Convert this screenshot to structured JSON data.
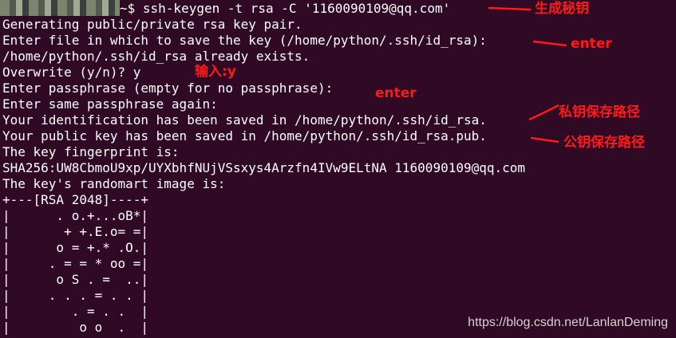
{
  "terminal": {
    "command": "~$ ssh-keygen -t rsa -C '1160090109@qq.com'",
    "output_lines": [
      "Generating public/private rsa key pair.",
      "Enter file in which to save the key (/home/python/.ssh/id_rsa):",
      "/home/python/.ssh/id_rsa already exists.",
      "Overwrite (y/n)? y",
      "Enter passphrase (empty for no passphrase):",
      "Enter same passphrase again:",
      "Your identification has been saved in /home/python/.ssh/id_rsa.",
      "Your public key has been saved in /home/python/.ssh/id_rsa.pub.",
      "The key fingerprint is:",
      "SHA256:UW8CbmoU9xp/UYXbhfNUjVSsxys4Arzfn4IVw9ELtNA 1160090109@qq.com",
      "The key's randomart image is:",
      "+---[RSA 2048]----+",
      "|      . o.+...oB*|",
      "|       + +.E.o= =|",
      "|      o = +.* .O.|",
      "|     . = = * oo =|",
      "|      o S . =  ..|",
      "|     . . . = . . |",
      "|        . = . .  |",
      "|         o o  .  |"
    ]
  },
  "annotations": {
    "generate_key": "生成秘钥",
    "enter_1": "enter",
    "input_y": "输入:y",
    "enter_2": "enter",
    "private_key_path": "私钥保存路径",
    "public_key_path": "公钥保存路径"
  },
  "watermark": "https://blog.csdn.net/LanlanDeming",
  "colors": {
    "background": "#300a24",
    "text": "#ffffff",
    "annotation": "#ff1a1a"
  }
}
